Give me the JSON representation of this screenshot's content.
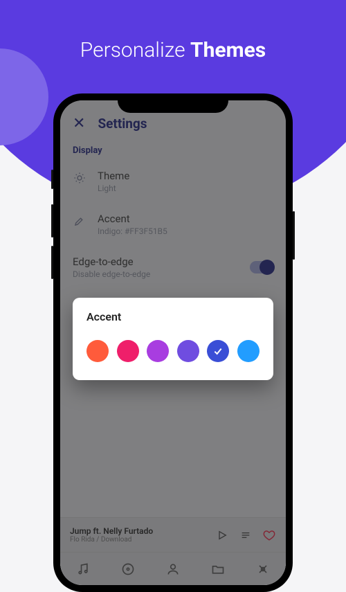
{
  "hero": {
    "line_a": "Personalize",
    "line_b": "Themes"
  },
  "header": {
    "title": "Settings"
  },
  "section_display": "Display",
  "rows": {
    "theme": {
      "label": "Theme",
      "value": "Light"
    },
    "accent": {
      "label": "Accent",
      "value": "Indigo: #FF3F51B5"
    },
    "edge": {
      "label": "Edge-to-edge",
      "value": "Disable edge-to-edge"
    }
  },
  "modal": {
    "title": "Accent",
    "colors": [
      "#ff5b3b",
      "#ef1f6a",
      "#a83de0",
      "#6f4de0",
      "#3a4ed6",
      "#229dff"
    ],
    "selected_index": 4
  },
  "now_playing": {
    "title": "Jump ft. Nelly Furtado",
    "subtitle": "Flo Rida / Download"
  }
}
